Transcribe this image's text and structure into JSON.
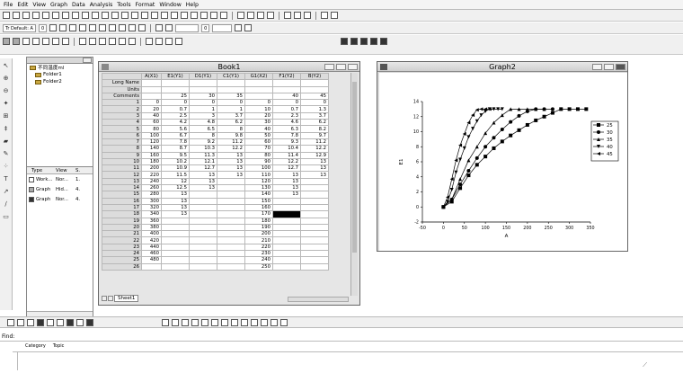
{
  "menu": [
    "File",
    "Edit",
    "View",
    "Graph",
    "Data",
    "Analysis",
    "Tools",
    "Format",
    "Window",
    "Help"
  ],
  "toolbar2": {
    "font_label": "Tr Default: A",
    "font_size": "0",
    "size2": "0"
  },
  "project": {
    "root": "不同温度ml",
    "folders": [
      "Folder1",
      "Folder2"
    ],
    "list_header": [
      "Type",
      "View",
      "S."
    ],
    "list_rows": [
      [
        "Work...",
        "Nor...",
        "1."
      ],
      [
        "Graph",
        "Hid...",
        "4."
      ],
      [
        "Graph",
        "Nor...",
        "4."
      ]
    ]
  },
  "book": {
    "title": "Book1",
    "columns": [
      "A(X1)",
      "E1(Y1)",
      "D1(Y1)",
      "C1(Y1)",
      "G1(X2)",
      "F1(Y2)",
      "B(Y2)"
    ],
    "meta_rows": [
      {
        "label": "Long Name",
        "values": [
          "",
          "",
          "",
          "",
          "",
          "",
          ""
        ]
      },
      {
        "label": "Units",
        "values": [
          "",
          "",
          "",
          "",
          "",
          "",
          ""
        ]
      },
      {
        "label": "Comments",
        "values": [
          "",
          "25",
          "30",
          "35",
          "",
          "40",
          "45"
        ]
      }
    ],
    "rows": [
      [
        "0",
        "0",
        "0",
        "0",
        "0",
        "0",
        "0"
      ],
      [
        "20",
        "0.7",
        "1",
        "1",
        "10",
        "0.7",
        "1.3"
      ],
      [
        "40",
        "2.5",
        "3",
        "3.7",
        "20",
        "2.3",
        "3.7"
      ],
      [
        "60",
        "4.2",
        "4.8",
        "6.2",
        "30",
        "4.6",
        "6.2"
      ],
      [
        "80",
        "5.6",
        "6.5",
        "8",
        "40",
        "6.3",
        "8.2"
      ],
      [
        "100",
        "6.7",
        "8",
        "9.8",
        "50",
        "7.8",
        "9.7"
      ],
      [
        "120",
        "7.8",
        "9.2",
        "11.2",
        "60",
        "9.3",
        "11.2"
      ],
      [
        "140",
        "8.7",
        "10.3",
        "12.2",
        "70",
        "10.4",
        "12.2"
      ],
      [
        "160",
        "9.5",
        "11.3",
        "13",
        "80",
        "11.4",
        "12.9"
      ],
      [
        "180",
        "10.2",
        "12.1",
        "13",
        "90",
        "12.2",
        "13"
      ],
      [
        "200",
        "10.9",
        "12.7",
        "13",
        "100",
        "12.7",
        "13"
      ],
      [
        "220",
        "11.5",
        "13",
        "13",
        "110",
        "13",
        "13"
      ],
      [
        "240",
        "12",
        "13",
        "",
        "120",
        "13",
        ""
      ],
      [
        "260",
        "12.5",
        "13",
        "",
        "130",
        "13",
        ""
      ],
      [
        "280",
        "13",
        "",
        "",
        "140",
        "13",
        ""
      ],
      [
        "300",
        "13",
        "",
        "",
        "150",
        "",
        ""
      ],
      [
        "320",
        "13",
        "",
        "",
        "160",
        "",
        ""
      ],
      [
        "340",
        "13",
        "",
        "",
        "170",
        "",
        ""
      ],
      [
        "360",
        "",
        "",
        "",
        "180",
        "",
        ""
      ],
      [
        "380",
        "",
        "",
        "",
        "190",
        "",
        ""
      ],
      [
        "400",
        "",
        "",
        "",
        "200",
        "",
        ""
      ],
      [
        "420",
        "",
        "",
        "",
        "210",
        "",
        ""
      ],
      [
        "440",
        "",
        "",
        "",
        "220",
        "",
        ""
      ],
      [
        "460",
        "",
        "",
        "",
        "230",
        "",
        ""
      ],
      [
        "480",
        "",
        "",
        "",
        "240",
        "",
        ""
      ],
      [
        "",
        "",
        "",
        "",
        "250",
        "",
        ""
      ]
    ],
    "sheet_tab": "Sheet1"
  },
  "graph": {
    "title": "Graph2",
    "layer": "1"
  },
  "chart_data": {
    "type": "line",
    "xlabel": "A",
    "ylabel": "E1",
    "xlim": [
      -50,
      350
    ],
    "ylim": [
      -2,
      14
    ],
    "xticks": [
      -50,
      0,
      50,
      100,
      150,
      200,
      250,
      300,
      350
    ],
    "yticks": [
      -2,
      0,
      2,
      4,
      6,
      8,
      10,
      12,
      14
    ],
    "legend_position": "right",
    "series": [
      {
        "name": "25",
        "marker": "square",
        "x": [
          0,
          20,
          40,
          60,
          80,
          100,
          120,
          140,
          160,
          180,
          200,
          220,
          240,
          260,
          280,
          300,
          320,
          340
        ],
        "y": [
          0,
          0.7,
          2.5,
          4.2,
          5.6,
          6.7,
          7.8,
          8.7,
          9.5,
          10.2,
          10.9,
          11.5,
          12,
          12.5,
          13,
          13,
          13,
          13
        ]
      },
      {
        "name": "30",
        "marker": "circle",
        "x": [
          0,
          20,
          40,
          60,
          80,
          100,
          120,
          140,
          160,
          180,
          200,
          220,
          240,
          260
        ],
        "y": [
          0,
          1,
          3,
          4.8,
          6.5,
          8,
          9.2,
          10.3,
          11.3,
          12.1,
          12.7,
          13,
          13,
          13
        ]
      },
      {
        "name": "35",
        "marker": "triangle-up",
        "x": [
          0,
          20,
          40,
          60,
          80,
          100,
          120,
          140,
          160,
          180,
          200,
          220,
          240
        ],
        "y": [
          0,
          1,
          3.7,
          6.2,
          8,
          9.8,
          11.2,
          12.2,
          13,
          13,
          13,
          13,
          13
        ]
      },
      {
        "name": "40",
        "marker": "triangle-down",
        "x": [
          0,
          10,
          20,
          30,
          40,
          50,
          60,
          70,
          80,
          90,
          100,
          110,
          120,
          130,
          140
        ],
        "y": [
          0,
          0.7,
          2.3,
          4.6,
          6.3,
          7.8,
          9.3,
          10.4,
          11.4,
          12.2,
          12.7,
          13,
          13,
          13,
          13
        ]
      },
      {
        "name": "45",
        "marker": "triangle-left",
        "x": [
          0,
          10,
          20,
          30,
          40,
          50,
          60,
          70,
          80,
          90,
          100,
          110
        ],
        "y": [
          0,
          1.3,
          3.7,
          6.2,
          8.2,
          9.7,
          11.2,
          12.2,
          12.9,
          13,
          13,
          13
        ]
      }
    ]
  },
  "find": {
    "label": "Find:"
  },
  "help": {
    "category": "Category",
    "topic": "Topic"
  }
}
